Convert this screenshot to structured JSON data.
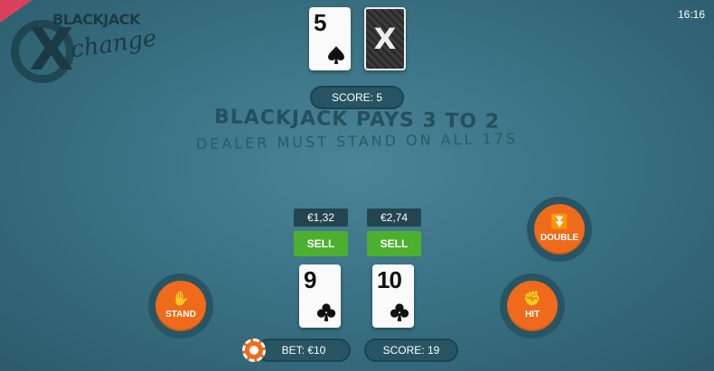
{
  "clock": "16:16",
  "logo": {
    "line1": "BLACKJACK",
    "mark": "X",
    "line2": "change"
  },
  "dealer": {
    "card": {
      "rank": "5",
      "suit": "spades"
    },
    "hidden_card_mark": "X",
    "score_label": "SCORE: 5"
  },
  "table": {
    "pays_text": "BLACKJACK PAYS 3 TO 2",
    "dealer_rule": "DEALER MUST STAND ON ALL 17S"
  },
  "player": {
    "cards": [
      {
        "rank": "9",
        "suit": "clubs",
        "sell_price": "€1,32",
        "sell_label": "SELL"
      },
      {
        "rank": "10",
        "suit": "clubs",
        "sell_price": "€2,74",
        "sell_label": "SELL"
      }
    ],
    "bet_label": "BET: €10",
    "score_label": "SCORE: 19"
  },
  "actions": {
    "stand": {
      "label": "STAND",
      "icon": "hand-icon"
    },
    "double": {
      "label": "DOUBLE",
      "icon": "double-chevron-icon"
    },
    "hit": {
      "label": "HIT",
      "icon": "fist-icon"
    }
  },
  "colors": {
    "action": "#f06a1c",
    "sell": "#4caf2e",
    "felt": "#3a7385"
  }
}
